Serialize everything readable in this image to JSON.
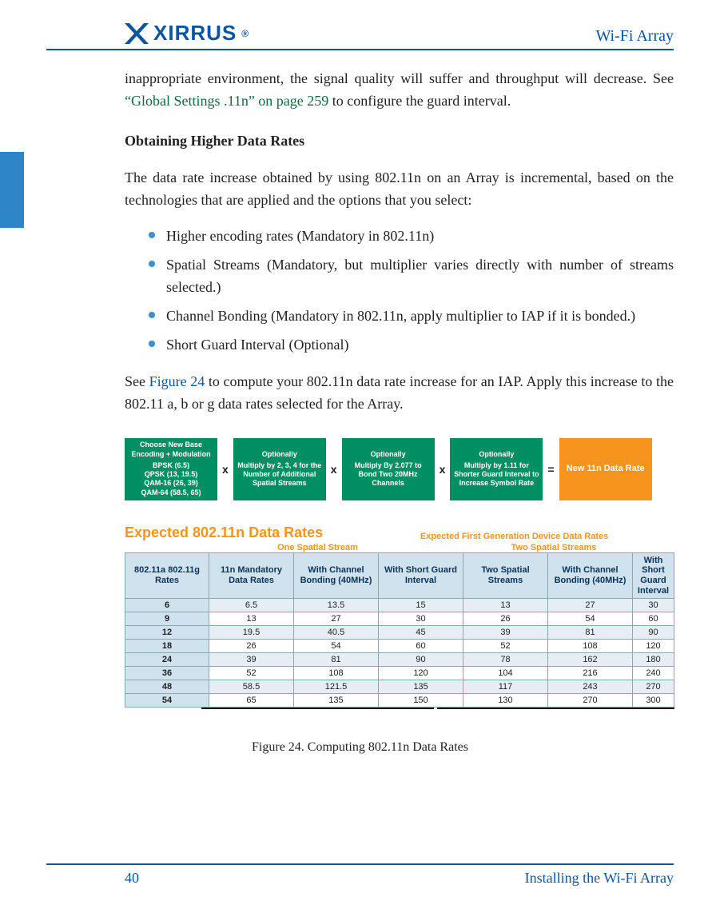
{
  "header": {
    "logo_text": "XIRRUS",
    "doc_title": "Wi-Fi Array"
  },
  "intro": {
    "para1a": "inappropriate environment, the signal quality will suffer and throughput will decrease. See ",
    "para1_link": "“Global Settings .11n” on page 259",
    "para1b": " to configure the guard interval."
  },
  "section": {
    "heading": "Obtaining Higher Data Rates",
    "lead": "The data rate increase obtained by using 802.11n on an Array is incremental, based on the technologies that are applied and the options that you select:",
    "bullets": [
      "Higher encoding rates (Mandatory in 802.11n)",
      "Spatial Streams (Mandatory, but multiplier varies directly with number of streams selected.)",
      "Channel Bonding (Mandatory in 802.11n, apply multiplier to IAP if it is bonded.)",
      "Short Guard Interval (Optional)"
    ],
    "tail_a": "See ",
    "tail_link": "Figure 24",
    "tail_b": " to compute your 802.11n data rate increase for an IAP. Apply this increase to the 802.11 a, b or g data rates selected for the Array."
  },
  "formula": {
    "boxes": [
      {
        "title": "Choose New Base Encoding + Modulation",
        "body": "BPSK  (6.5)\nQPSK (13, 19.5)\nQAM-16 (26, 39)\nQAM-64 (58.5, 65)"
      },
      {
        "title": "Optionally",
        "body": "Multiply by 2, 3, 4 for the Number of Additional Spatial Streams"
      },
      {
        "title": "Optionally",
        "body": "Multiply By 2.077 to Bond Two 20MHz Channels"
      },
      {
        "title": "Optionally",
        "body": "Multiply by 1.11 for Shorter Guard Interval to Increase Symbol Rate"
      },
      {
        "title": "",
        "body": "New 11n Data Rate"
      }
    ],
    "ops": [
      "x",
      "x",
      "x",
      "="
    ]
  },
  "table": {
    "title": "Expected 802.11n Data Rates",
    "subtitle": "Expected First Generation Device Data Rates",
    "group1": "One Spatial Stream",
    "group2": "Two Spatial Streams",
    "headers": [
      "802.11a 802.11g Rates",
      "11n Mandatory Data Rates",
      "With Channel Bonding (40MHz)",
      "With Short Guard Interval",
      "Two Spatial Streams",
      "With Channel Bonding (40MHz)",
      "With Short Guard Interval"
    ],
    "rows": [
      [
        "6",
        "6.5",
        "13.5",
        "15",
        "13",
        "27",
        "30"
      ],
      [
        "9",
        "13",
        "27",
        "30",
        "26",
        "54",
        "60"
      ],
      [
        "12",
        "19.5",
        "40.5",
        "45",
        "39",
        "81",
        "90"
      ],
      [
        "18",
        "26",
        "54",
        "60",
        "52",
        "108",
        "120"
      ],
      [
        "24",
        "39",
        "81",
        "90",
        "78",
        "162",
        "180"
      ],
      [
        "36",
        "52",
        "108",
        "120",
        "104",
        "216",
        "240"
      ],
      [
        "48",
        "58.5",
        "121.5",
        "135",
        "117",
        "243",
        "270"
      ],
      [
        "54",
        "65",
        "135",
        "150",
        "130",
        "270",
        "300"
      ]
    ]
  },
  "caption": "Figure 24. Computing 802.11n Data Rates",
  "footer": {
    "page": "40",
    "section": "Installing the Wi-Fi Array"
  },
  "chart_data": {
    "type": "table",
    "title": "Expected 802.11n Data Rates",
    "columns": [
      "802.11a/802.11g Rates",
      "11n Mandatory Data Rates",
      "One Spatial Stream – With Channel Bonding (40MHz)",
      "One Spatial Stream – With Short Guard Interval",
      "Two Spatial Streams",
      "Two Spatial Streams – With Channel Bonding (40MHz)",
      "Two Spatial Streams – With Short Guard Interval"
    ],
    "data": [
      [
        6,
        6.5,
        13.5,
        15,
        13,
        27,
        30
      ],
      [
        9,
        13,
        27,
        30,
        26,
        54,
        60
      ],
      [
        12,
        19.5,
        40.5,
        45,
        39,
        81,
        90
      ],
      [
        18,
        26,
        54,
        60,
        52,
        108,
        120
      ],
      [
        24,
        39,
        81,
        90,
        78,
        162,
        180
      ],
      [
        36,
        52,
        108,
        120,
        104,
        216,
        240
      ],
      [
        48,
        58.5,
        121.5,
        135,
        117,
        243,
        270
      ],
      [
        54,
        65,
        135,
        150,
        130,
        270,
        300
      ]
    ]
  }
}
